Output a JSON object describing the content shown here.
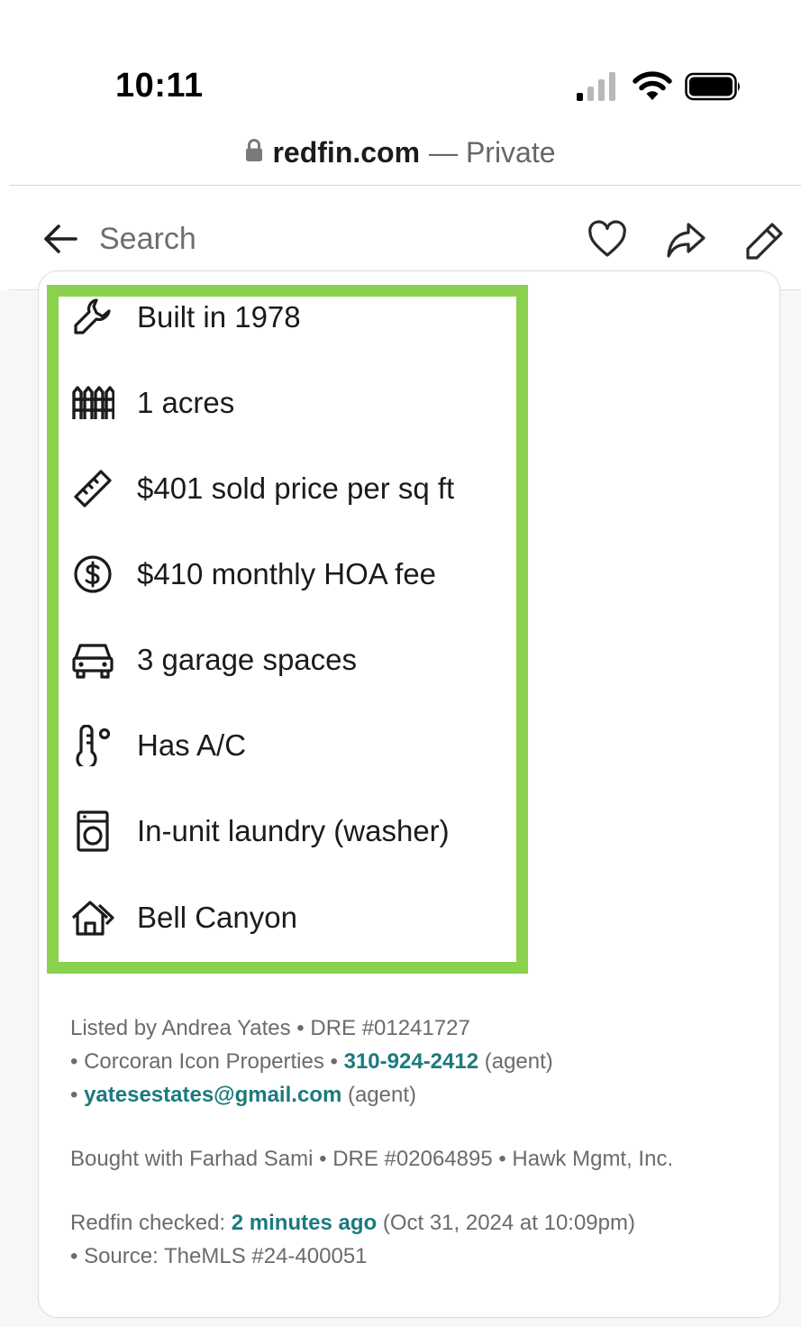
{
  "status_bar": {
    "time": "10:11"
  },
  "url_bar": {
    "domain": "redfin.com",
    "mode": "— Private"
  },
  "nav": {
    "search_label": "Search",
    "icons": [
      "arrow-left-icon",
      "heart-icon",
      "share-icon",
      "pencil-icon"
    ]
  },
  "facts": [
    {
      "icon": "wrench-icon",
      "text": "Built in 1978"
    },
    {
      "icon": "fence-icon",
      "text": "1 acres"
    },
    {
      "icon": "ruler-icon",
      "text": "$401 sold price per sq ft"
    },
    {
      "icon": "dollar-circle-icon",
      "text": "$410 monthly HOA fee"
    },
    {
      "icon": "car-icon",
      "text": "3 garage spaces"
    },
    {
      "icon": "thermometer-icon",
      "text": "Has A/C"
    },
    {
      "icon": "washer-icon",
      "text": "In-unit laundry (washer)"
    },
    {
      "icon": "house-icon",
      "text": "Bell Canyon"
    }
  ],
  "listing": {
    "listed_by": "Listed by Andrea Yates • DRE #01241727",
    "brokerage": "•  Corcoran Icon Properties • ",
    "agent_phone": "310-924-2412",
    "agent_tag": " (agent)",
    "email_prefix": "• ",
    "agent_email": "yatesestates@gmail.com",
    "email_tag": " (agent)",
    "bought_with": "Bought with Farhad Sami • DRE #02064895 •  Hawk Mgmt, Inc.",
    "checked_label": "Redfin checked: ",
    "checked_relative": "2 minutes ago",
    "checked_absolute": " (Oct 31, 2024 at 10:09pm)",
    "source": " • Source:  TheMLS #24-400051"
  },
  "colors": {
    "highlight": "#8bd14e",
    "link": "#1b7a7f"
  }
}
